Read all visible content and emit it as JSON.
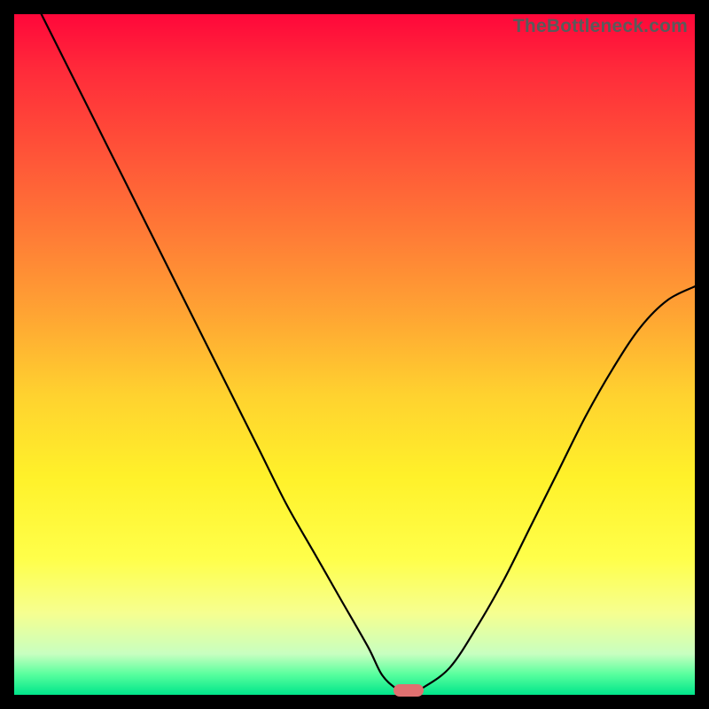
{
  "attribution": "TheBottleneck.com",
  "chart_data": {
    "type": "line",
    "title": "",
    "xlabel": "",
    "ylabel": "",
    "xlim": [
      0,
      100
    ],
    "ylim": [
      0,
      100
    ],
    "series": [
      {
        "name": "bottleneck-curve",
        "x": [
          4,
          8,
          12,
          16,
          20,
          24,
          28,
          32,
          36,
          40,
          44,
          48,
          52,
          54,
          56,
          58,
          60,
          64,
          68,
          72,
          76,
          80,
          84,
          88,
          92,
          96,
          100
        ],
        "y": [
          100,
          92,
          84,
          76,
          68,
          60,
          52,
          44,
          36,
          28,
          21,
          14,
          7,
          3,
          1,
          0,
          1,
          4,
          10,
          17,
          25,
          33,
          41,
          48,
          54,
          58,
          60
        ]
      }
    ],
    "marker": {
      "x": 58,
      "y": 0.6
    },
    "background_gradient": {
      "top": "#ff073a",
      "mid": "#ffd22f",
      "bottom": "#00e58a"
    }
  }
}
